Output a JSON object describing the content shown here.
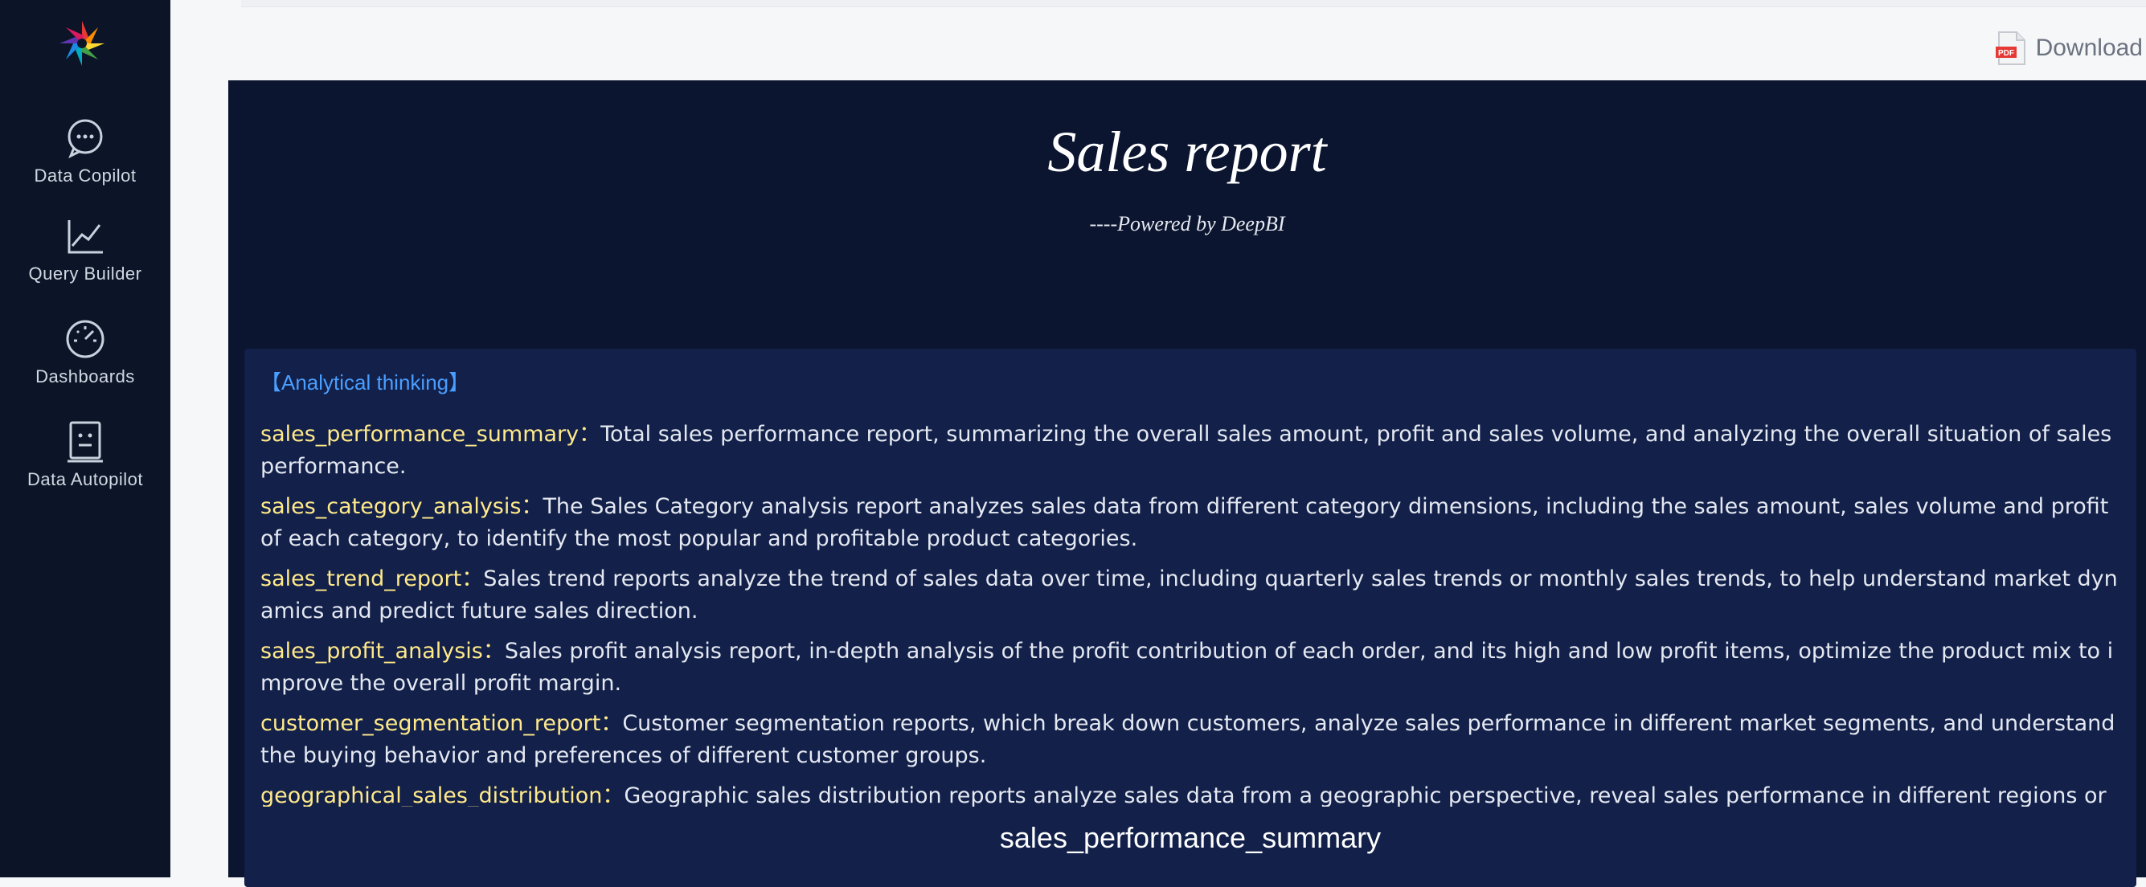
{
  "sidebar": {
    "items": [
      {
        "label": "Data Copilot",
        "icon": "chat-bubbles-icon"
      },
      {
        "label": "Query Builder",
        "icon": "line-chart-icon"
      },
      {
        "label": "Dashboards",
        "icon": "gauge-icon"
      },
      {
        "label": "Data Autopilot",
        "icon": "robot-icon"
      }
    ]
  },
  "toolbar": {
    "download_label": "Download"
  },
  "report": {
    "title": "Sales report",
    "subtitle": "----Powered by DeepBI",
    "thinking_heading": "【Analytical thinking】",
    "items": [
      {
        "key": "sales_performance_summary：",
        "text": "Total sales performance report, summarizing the overall sales amount, profit and sales volume, and analyzing the overall situation of sales performance."
      },
      {
        "key": "sales_category_analysis：",
        "text": "The Sales Category analysis report analyzes sales data from different category dimensions, including the sales amount, sales volume and profit of each category, to identify the most popular and profitable product categories."
      },
      {
        "key": "sales_trend_report：",
        "text": "Sales trend reports analyze the trend of sales data over time, including quarterly sales trends or monthly sales trends, to help understand market dynamics and predict future sales direction."
      },
      {
        "key": "sales_profit_analysis：",
        "text": "Sales profit analysis report, in-depth analysis of the profit contribution of each order, and its high and low profit items, optimize the product mix to improve the overall profit margin."
      },
      {
        "key": "customer_segmentation_report：",
        "text": "Customer segmentation reports, which break down customers, analyze sales performance in different market segments, and understand the buying behavior and preferences of different customer groups."
      },
      {
        "key": "geographical_sales_distribution：",
        "text": "Geographic sales distribution reports analyze sales data from a geographic perspective, reveal sales performance in different regions or markets, find new market opportunities or allocate resources in regional markets."
      }
    ],
    "section_title": "sales_performance_summary"
  },
  "colors": {
    "sidebar_bg": "#0b1527",
    "report_bg": "#0b1530",
    "card_bg": "#12204a",
    "key_color": "#ffe98a",
    "heading_color": "#4a9eff"
  }
}
